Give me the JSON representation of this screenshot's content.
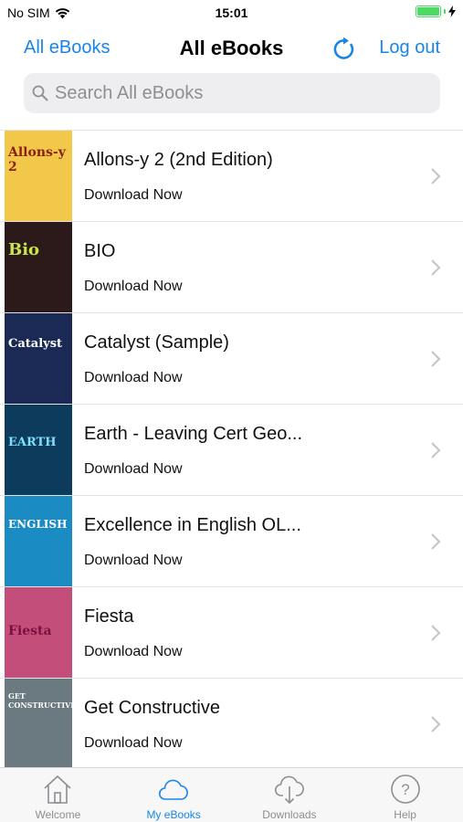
{
  "status_bar": {
    "carrier": "No SIM",
    "time": "15:01",
    "battery_level": 1.0,
    "wifi_icon": "wifi-icon",
    "charging_icon": "bolt-icon"
  },
  "nav": {
    "back_label": "All eBooks",
    "title": "All eBooks",
    "refresh_icon": "refresh-icon",
    "logout_label": "Log out"
  },
  "search": {
    "placeholder": "Search All eBooks",
    "value": ""
  },
  "books": [
    {
      "title": "Allons-y 2 (2nd Edition)",
      "action": "Download Now",
      "cover_text": "Allons-y 2",
      "cover_color": "#f2c84b"
    },
    {
      "title": "BIO",
      "action": "Download Now",
      "cover_text": "Bio",
      "cover_color": "#2c1a1a"
    },
    {
      "title": "Catalyst (Sample)",
      "action": "Download Now",
      "cover_text": "Catalyst",
      "cover_color": "#1b2a55"
    },
    {
      "title": "Earth - Leaving Cert Geo...",
      "action": "Download Now",
      "cover_text": "EARTH",
      "cover_color": "#0d3b5c"
    },
    {
      "title": "Excellence in English OL...",
      "action": "Download Now",
      "cover_text": "ENGLISH",
      "cover_color": "#1b8bc4"
    },
    {
      "title": "Fiesta",
      "action": "Download Now",
      "cover_text": "Fiesta",
      "cover_color": "#c44e7a"
    },
    {
      "title": "Get Constructive",
      "action": "Download Now",
      "cover_text": "GET CONSTRUCTIVE",
      "cover_color": "#6a7a80"
    }
  ],
  "tabs": [
    {
      "label": "Welcome",
      "icon": "home-icon",
      "active": false
    },
    {
      "label": "My eBooks",
      "icon": "cloud-icon",
      "active": true
    },
    {
      "label": "Downloads",
      "icon": "cloud-download-icon",
      "active": false
    },
    {
      "label": "Help",
      "icon": "help-icon",
      "active": false
    }
  ],
  "colors": {
    "accent": "#1a85e6",
    "inactive": "#8e8e93",
    "battery": "#4cd964"
  }
}
